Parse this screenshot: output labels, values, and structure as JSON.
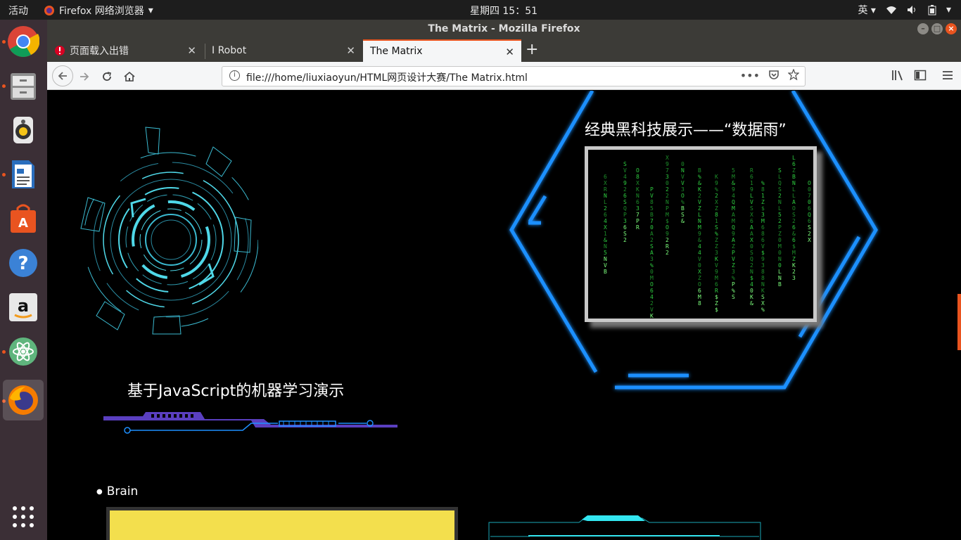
{
  "topbar": {
    "activities": "活动",
    "app_name": "Firefox 网络浏览器",
    "clock": "星期四 15：51",
    "ime": "英"
  },
  "dock": {
    "items": [
      "chrome",
      "files",
      "rhythmbox",
      "libreoffice-writer",
      "software-center",
      "help",
      "amazon",
      "atom",
      "firefox"
    ]
  },
  "window": {
    "title": "The Matrix - Mozilla Firefox"
  },
  "tabs": [
    {
      "label": "页面载入出错",
      "error": true
    },
    {
      "label": "I Robot"
    },
    {
      "label": "The Matrix",
      "selected": true
    }
  ],
  "navbar": {
    "url": "file:///home/liuxiaoyun/HTML网页设计大赛/The Matrix.html"
  },
  "page": {
    "js_demo_title": "基于JavaScript的机器学习演示",
    "matrix_title": "经典黑科技展示——“数据雨”",
    "brain_label": "Brain"
  },
  "colors": {
    "accent": "#e9541f",
    "hex_blue": "#1e90ff",
    "cyan": "#4fd8e8",
    "purple": "#5a3fc0",
    "matrix_green": "#3cff3c",
    "yellow": "#f3df4d"
  }
}
